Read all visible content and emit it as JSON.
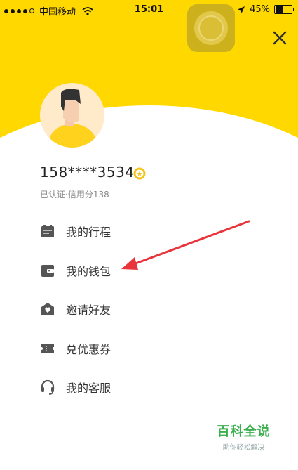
{
  "status_bar": {
    "carrier": "中国移动",
    "time": "15:01",
    "battery_pct": "45%",
    "battery_level": 0.45
  },
  "profile": {
    "phone": "158****3534",
    "verify_text": "已认证·信用分138"
  },
  "menu": [
    {
      "label": "我的行程",
      "icon": "trip-icon"
    },
    {
      "label": "我的钱包",
      "icon": "wallet-icon"
    },
    {
      "label": "邀请好友",
      "icon": "invite-icon"
    },
    {
      "label": "兑优惠券",
      "icon": "coupon-icon"
    },
    {
      "label": "我的客服",
      "icon": "headset-icon"
    }
  ],
  "watermark": {
    "title": "百科全说",
    "subtitle": "助你轻松解决"
  },
  "colors": {
    "brand_yellow": "#FFD800",
    "icon_gray": "#555555",
    "arrow_red": "#E8343A",
    "watermark_green": "#3BAF4E"
  }
}
